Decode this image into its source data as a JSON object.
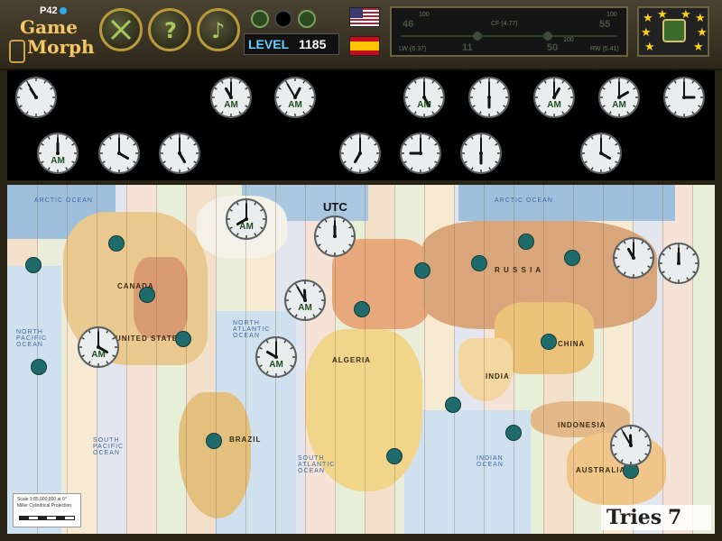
{
  "header": {
    "logo": {
      "badge": "P42",
      "line1": "Game",
      "line2": "Morph"
    },
    "buttons": [
      {
        "name": "close-button",
        "icon": "crossed-swords-icon"
      },
      {
        "name": "help-button",
        "icon": "question-mark-icon"
      },
      {
        "name": "music-button",
        "icon": "music-note-icon"
      }
    ],
    "level": {
      "label": "LEVEL",
      "value": "1185"
    },
    "languages": [
      {
        "name": "english-flag",
        "flag": "us"
      },
      {
        "name": "spanish-flag",
        "flag": "es"
      }
    ],
    "stats": {
      "left_top": "46",
      "left_bottom": "11",
      "right_top": "55",
      "right_bottom": "50",
      "small_a": "100",
      "small_b": "100",
      "small_c": "100",
      "mid_label": "CF (4.77)",
      "left_label": "LW (6.37)",
      "right_label": "RW (5.41)"
    }
  },
  "clock_strip": [
    {
      "h": 10,
      "m": 55,
      "ampm": ""
    },
    {
      "h": 11,
      "m": 0,
      "ampm": "AM"
    },
    {
      "h": 12,
      "m": 55,
      "ampm": "AM"
    },
    {
      "h": 5,
      "m": 0,
      "ampm": "AM"
    },
    {
      "h": 6,
      "m": 0,
      "ampm": ""
    },
    {
      "h": 1,
      "m": 0,
      "ampm": "AM"
    },
    {
      "h": 2,
      "m": 0,
      "ampm": "AM"
    },
    {
      "h": 3,
      "m": 0,
      "ampm": ""
    },
    {
      "h": 12,
      "m": 0,
      "ampm": "AM"
    },
    {
      "h": 4,
      "m": 0,
      "ampm": ""
    },
    {
      "h": 5,
      "m": 0,
      "ampm": ""
    },
    {
      "h": 7,
      "m": 0,
      "ampm": ""
    },
    {
      "h": 9,
      "m": 0,
      "ampm": ""
    },
    {
      "h": 6,
      "m": 0,
      "ampm": ""
    },
    {
      "h": 4,
      "m": 0,
      "ampm": ""
    }
  ],
  "map": {
    "utc_label": "UTC",
    "placed_clocks": [
      {
        "h": 8,
        "m": 0,
        "ampm": "AM"
      },
      {
        "h": 12,
        "m": 0,
        "ampm": ""
      },
      {
        "h": 11,
        "m": 55,
        "ampm": "AM"
      },
      {
        "h": 4,
        "m": 0,
        "ampm": "AM"
      },
      {
        "h": 10,
        "m": 0,
        "ampm": "AM"
      },
      {
        "h": 11,
        "m": 0,
        "ampm": ""
      },
      {
        "h": 12,
        "m": 0,
        "ampm": ""
      },
      {
        "h": 11,
        "m": 55,
        "ampm": ""
      }
    ],
    "labels": {
      "arctic_left": "ARCTIC OCEAN",
      "arctic_right": "ARCTIC OCEAN",
      "north_pacific": "NORTH PACIFIC OCEAN",
      "north_atlantic": "NORTH ATLANTIC OCEAN",
      "south_pacific": "SOUTH PACIFIC OCEAN",
      "south_atlantic": "SOUTH ATLANTIC OCEAN",
      "indian": "INDIAN OCEAN",
      "canada": "CANADA",
      "usa": "UNITED STATES",
      "brazil": "BRAZIL",
      "russia": "R U S S I A",
      "china": "CHINA",
      "india": "INDIA",
      "indonesia": "INDONESIA",
      "australia": "AUSTRALIA",
      "algeria": "ALGERIA"
    },
    "scale": {
      "line1": "Scale 1:85,000,000 at 0°",
      "line2": "Miller Cylindrical Projection"
    }
  },
  "tries": {
    "label": "Tries",
    "value": "7"
  }
}
